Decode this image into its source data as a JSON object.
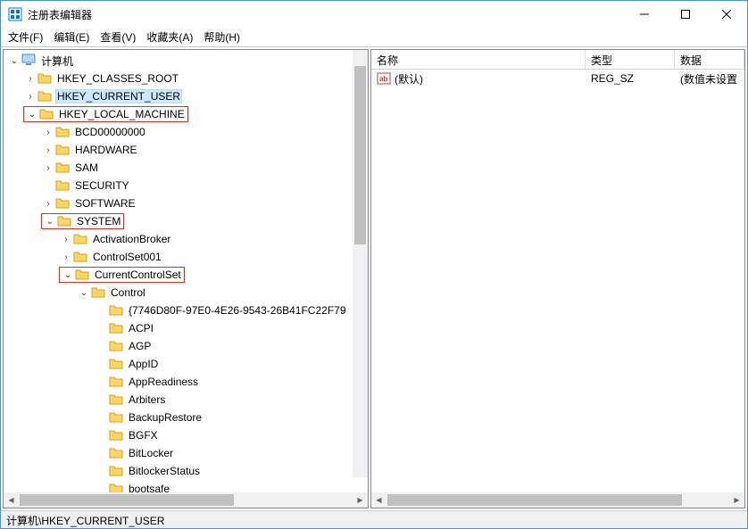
{
  "window": {
    "title": "注册表编辑器"
  },
  "menu": {
    "file": "文件(F)",
    "edit": "编辑(E)",
    "view": "查看(V)",
    "favorites": "收藏夹(A)",
    "help": "帮助(H)"
  },
  "tree": {
    "root": "计算机",
    "hkcr": "HKEY_CLASSES_ROOT",
    "hkcu": "HKEY_CURRENT_USER",
    "hklm": "HKEY_LOCAL_MACHINE",
    "bcd": "BCD00000000",
    "hardware": "HARDWARE",
    "sam": "SAM",
    "security": "SECURITY",
    "software": "SOFTWARE",
    "system": "SYSTEM",
    "activation": "ActivationBroker",
    "cs001": "ControlSet001",
    "ccs": "CurrentControlSet",
    "control": "Control",
    "guid": "{7746D80F-97E0-4E26-9543-26B41FC22F79",
    "acpi": "ACPI",
    "agp": "AGP",
    "appid": "AppID",
    "appreadiness": "AppReadiness",
    "arbiters": "Arbiters",
    "backuprestore": "BackupRestore",
    "bgfx": "BGFX",
    "bitlocker": "BitLocker",
    "bitlockerstatus": "BitlockerStatus",
    "bootsafe": "bootsafe"
  },
  "list": {
    "col_name": "名称",
    "col_type": "类型",
    "col_data": "数据",
    "default_name": "(默认)",
    "default_type": "REG_SZ",
    "default_data": "(数值未设置"
  },
  "statusbar": {
    "path": "计算机\\HKEY_CURRENT_USER"
  }
}
